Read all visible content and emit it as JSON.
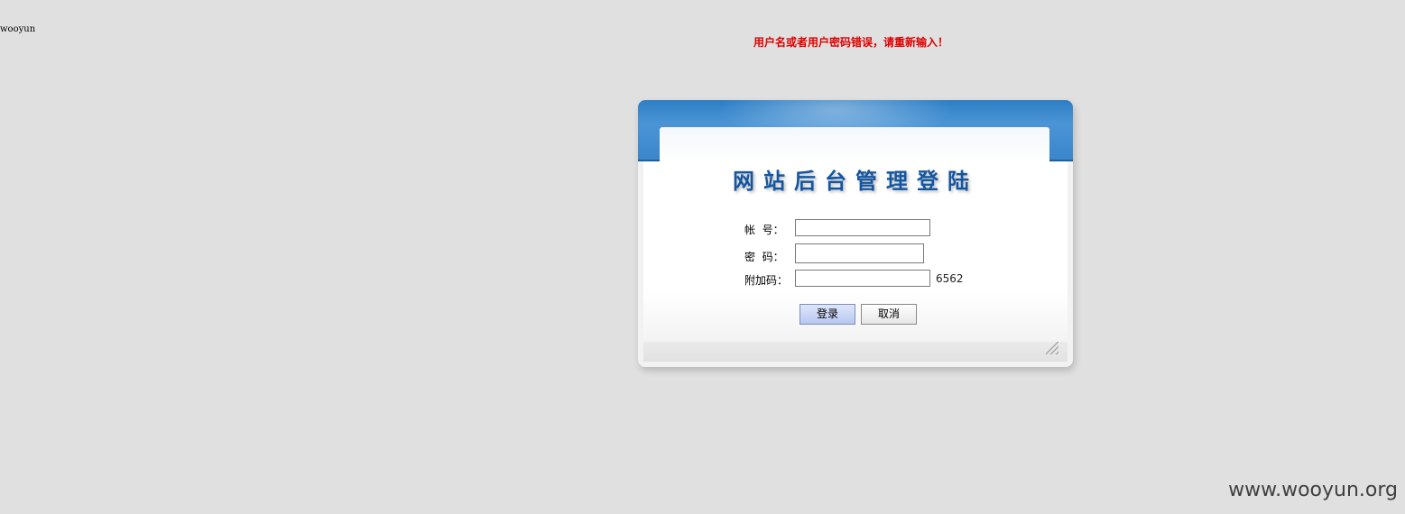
{
  "corner_text": "wooyun",
  "error_message": "用户名或者用户密码错误，请重新输入！",
  "login": {
    "title": "网站后台管理登陆",
    "account_label": "帐  号：",
    "password_label": "密  码：",
    "code_label": "附加码：",
    "account_value": "",
    "password_value": "",
    "code_input_value": "",
    "code_value": "6562",
    "login_button": "登录",
    "cancel_button": "取消"
  },
  "watermark": "www.wooyun.org",
  "colors": {
    "background": "#e0e0e0",
    "error": "#e00000",
    "header_blue": "#3a86cc",
    "title_blue": "#1556a0"
  }
}
